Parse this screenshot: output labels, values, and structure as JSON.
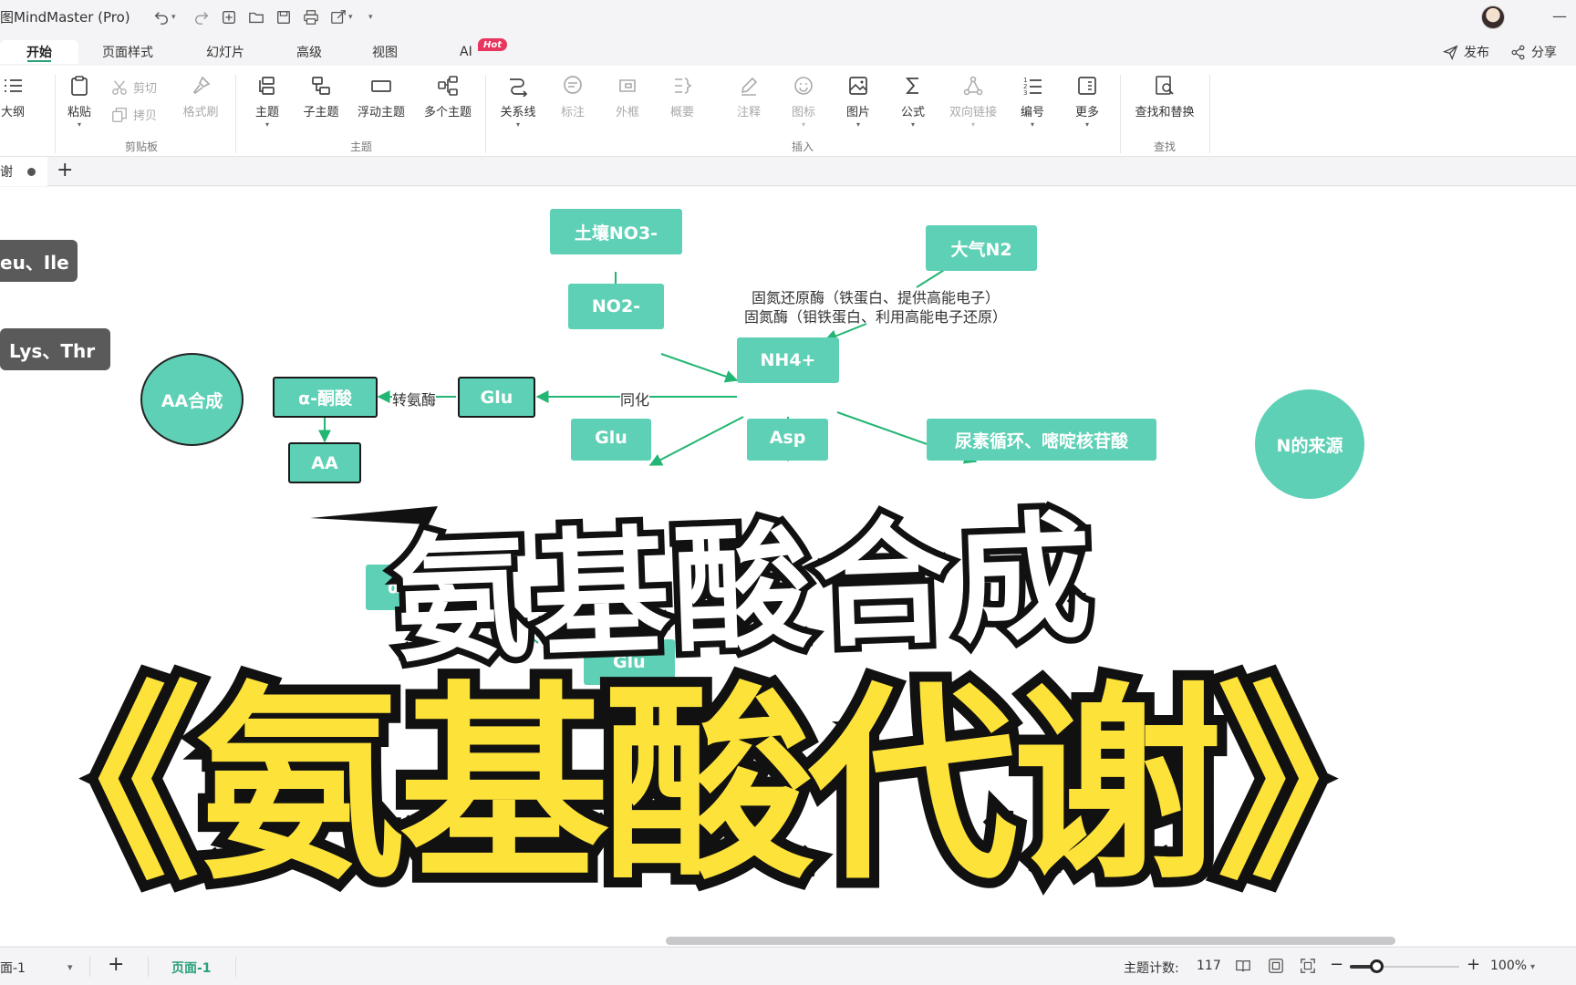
{
  "app": {
    "title": "图MindMaster (Pro)"
  },
  "menu": {
    "tabs": [
      {
        "label": "开始"
      },
      {
        "label": "页面样式"
      },
      {
        "label": "幻灯片"
      },
      {
        "label": "高级"
      },
      {
        "label": "视图"
      },
      {
        "label": "AI"
      }
    ],
    "hot_badge": "Hot",
    "publish": "发布",
    "share": "分享"
  },
  "ribbon": {
    "outline": "大纲",
    "paste": "粘贴",
    "cut": "剪切",
    "copy": "拷贝",
    "format_painter": "格式刷",
    "topic": "主题",
    "subtopic": "子主题",
    "floating_topic": "浮动主题",
    "multi_topic": "多个主题",
    "relation": "关系线",
    "callout": "标注",
    "boundary": "外框",
    "summary": "概要",
    "note": "注释",
    "icon": "图标",
    "image": "图片",
    "formula": "公式",
    "bilink": "双向链接",
    "numbering": "编号",
    "more": "更多",
    "find_replace": "查找和替换",
    "groups": {
      "clipboard": "剪贴板",
      "topic": "主题",
      "insert": "插入",
      "find": "查找"
    }
  },
  "doc_tab": {
    "label": "谢"
  },
  "mindmap": {
    "nodes": {
      "leu_ile": "eu、Ile",
      "lys_thr": "Lys、Thr",
      "aa_synth": "AA合成",
      "alpha_keto": "α-酮酸",
      "aa": "AA",
      "glu": "Glu",
      "soil_no3": "土壤NO3-",
      "no2": "NO2-",
      "nh4": "NH4+",
      "air_n2": "大气N2",
      "glu2": "Glu",
      "asp": "Asp",
      "urea": "尿素循环、嘧啶核苷酸",
      "n_source": "N的来源",
      "alpha_partial": "α-",
      "glu_partial": "Glu",
      "glu_partial2": "Glu"
    },
    "labels": {
      "transaminase": "转氨酶",
      "assimilation": "同化",
      "nitrogenase_reductase": "固氮还原酶（铁蛋白、提供高能电子）",
      "nitrogenase": "固氮酶（钼铁蛋白、利用高能电子还原）"
    }
  },
  "overlay": {
    "title_small": "氨基酸合成",
    "title_big": "《氨基酸代谢》"
  },
  "status": {
    "page_select": "面-1",
    "page_tab": "页面-1",
    "topic_count_label": "主题计数:",
    "topic_count": "117",
    "zoom": "100%",
    "zoom_level": 0.25
  },
  "colors": {
    "node_fill": "#5ed0b5",
    "edge": "#22b573",
    "accent": "#2ba07a",
    "hot": "#e8375e",
    "big_title": "#fde23a"
  }
}
